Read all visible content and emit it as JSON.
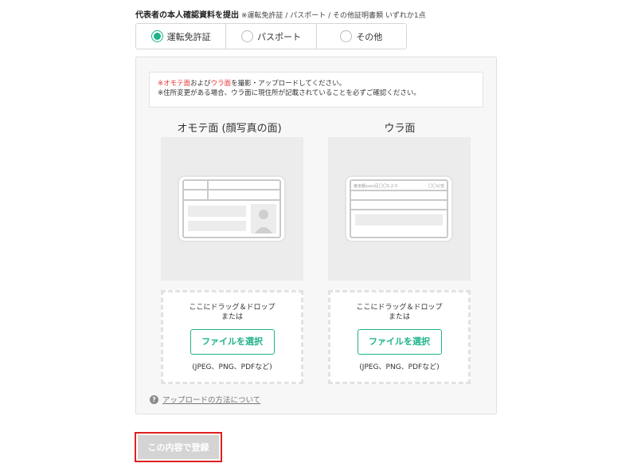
{
  "heading": {
    "title": "代表者の本人確認資料を提出",
    "note": "※運転免許証 / パスポート / その他証明書類 いずれか1点"
  },
  "doc_types": [
    {
      "label": "運転免許証",
      "selected": true
    },
    {
      "label": "パスポート",
      "selected": false
    },
    {
      "label": "その他",
      "selected": false
    }
  ],
  "notice": {
    "mark": "※",
    "front_word": "オモテ面",
    "and": "および",
    "back_word": "ウラ面",
    "line1_rest": "を撮影・アップロードしてください。",
    "line2": "※住所変更がある場合、ウラ面に現住所が記載されていることを必ずご確認ください。"
  },
  "front": {
    "title": "オモテ面 (顔写真の面)",
    "drop_line1": "ここにドラッグ＆ドロップ",
    "drop_line2": "または",
    "button": "ファイルを選択",
    "formats": "(JPEG、PNG、PDFなど)"
  },
  "back": {
    "title": "ウラ面",
    "card_address": "東京都xxxx区〇〇1-2-3",
    "card_stamp": "〇〇公安",
    "drop_line1": "ここにドラッグ＆ドロップ",
    "drop_line2": "または",
    "button": "ファイルを選択",
    "formats": "(JPEG、PNG、PDFなど)"
  },
  "help": {
    "icon": "question-circle-icon",
    "glyph": "?",
    "text": "アップロードの方法について"
  },
  "submit": {
    "label": "この内容で登録"
  },
  "colors": {
    "accent": "#20b38c",
    "notice_red": "#e53935",
    "highlight_border": "#e02020",
    "disabled_button": "#d4d4d4"
  }
}
